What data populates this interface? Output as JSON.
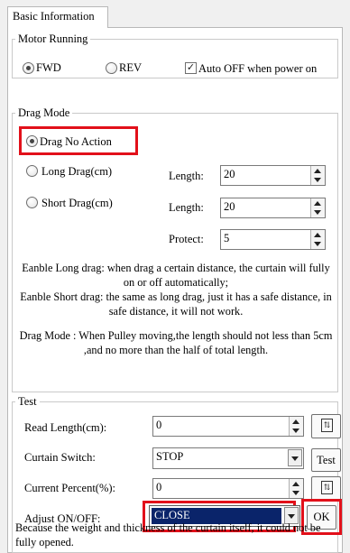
{
  "tab": {
    "label": "Basic Information"
  },
  "motor": {
    "legend": "Motor Running",
    "fwd": "FWD",
    "rev": "REV",
    "auto_off": "Auto OFF when power on",
    "selected": "FWD",
    "auto_off_checked": true
  },
  "drag": {
    "legend": "Drag Mode",
    "no_action": "Drag No Action",
    "long": "Long Drag(cm)",
    "short": "Short Drag(cm)",
    "selected": "Drag No Action",
    "length_label": "Length:",
    "protect_label": "Protect:",
    "long_length": "20",
    "short_length": "20",
    "protect": "5",
    "desc1": "Eanble Long drag: when drag a certain distance, the curtain will fully on or off automatically;",
    "desc2": "Eanble Short drag: the same as long drag, just it has a safe distance, in safe distance, it will not work.",
    "desc3": "Drag Mode : When Pulley moving,the length should not less than 5cm ,and no more than the half of total length."
  },
  "test": {
    "legend": "Test",
    "read_length_label": "Read Length(cm):",
    "read_length": "0",
    "curtain_switch_label": "Curtain Switch:",
    "curtain_switch": "STOP",
    "test_button": "Test",
    "current_percent_label": "Current Percent(%):",
    "current_percent": "0",
    "adjust_label": "Adjust ON/OFF:",
    "adjust_value": "CLOSE",
    "ok_button": "OK",
    "footnote": "Because the weight and thickness of the curtain itself, it could not be fully opened."
  },
  "colors": {
    "highlight": "#e2101a",
    "selection": "#0a246a"
  },
  "icons": {
    "refresh": "refresh-icon",
    "spin": "spin-icon",
    "dropdown": "chevron-down-icon"
  }
}
